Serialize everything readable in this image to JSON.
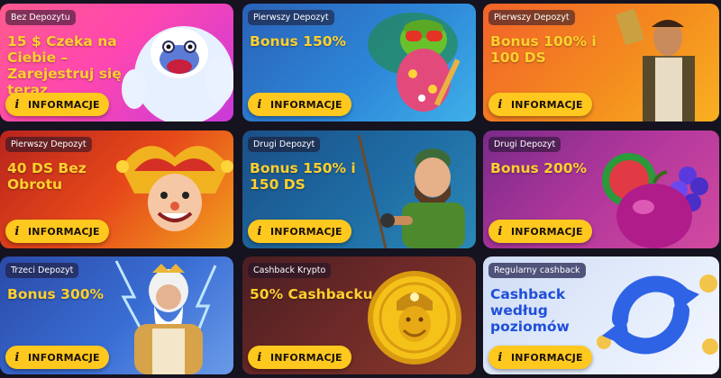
{
  "info_label": "INFORMACJE",
  "info_icon": "i",
  "cards": [
    {
      "badge": "Bez Depozytu",
      "title": "15 $ Czeka na Ciebie – Zarejestruj się teraz",
      "bg": "#ff4fa3",
      "art": "yeti"
    },
    {
      "badge": "Pierwszy Depozyt",
      "title": "Bonus 150%",
      "bg": "#2e7fd6",
      "art": "frog"
    },
    {
      "badge": "Pierwszy Depozyt",
      "title": "Bonus 100% i 100 DS",
      "bg": "#f0721f",
      "art": "explorer"
    },
    {
      "badge": "Pierwszy Depozyt",
      "title": "40 DS Bez Obrotu",
      "bg": "#e14b1a",
      "art": "joker"
    },
    {
      "badge": "Drugi Depozyt",
      "title": "Bonus 150% i 150 DS",
      "bg": "#1d6ca8",
      "art": "fisherman"
    },
    {
      "badge": "Drugi Depozyt",
      "title": "Bonus 200%",
      "bg": "#a3309b",
      "art": "plum"
    },
    {
      "badge": "Trzeci Depozyt",
      "title": "Bonus 300%",
      "bg": "#2f55b8",
      "art": "zeus"
    },
    {
      "badge": "Cashback Krypto",
      "title": "50% Cashbacku",
      "bg": "#6f2a28",
      "art": "coin"
    },
    {
      "badge": "Regularny cashback",
      "title": "Cashback według poziomów",
      "bg": "#dfe9fb",
      "art": "refresh-arrows"
    }
  ]
}
